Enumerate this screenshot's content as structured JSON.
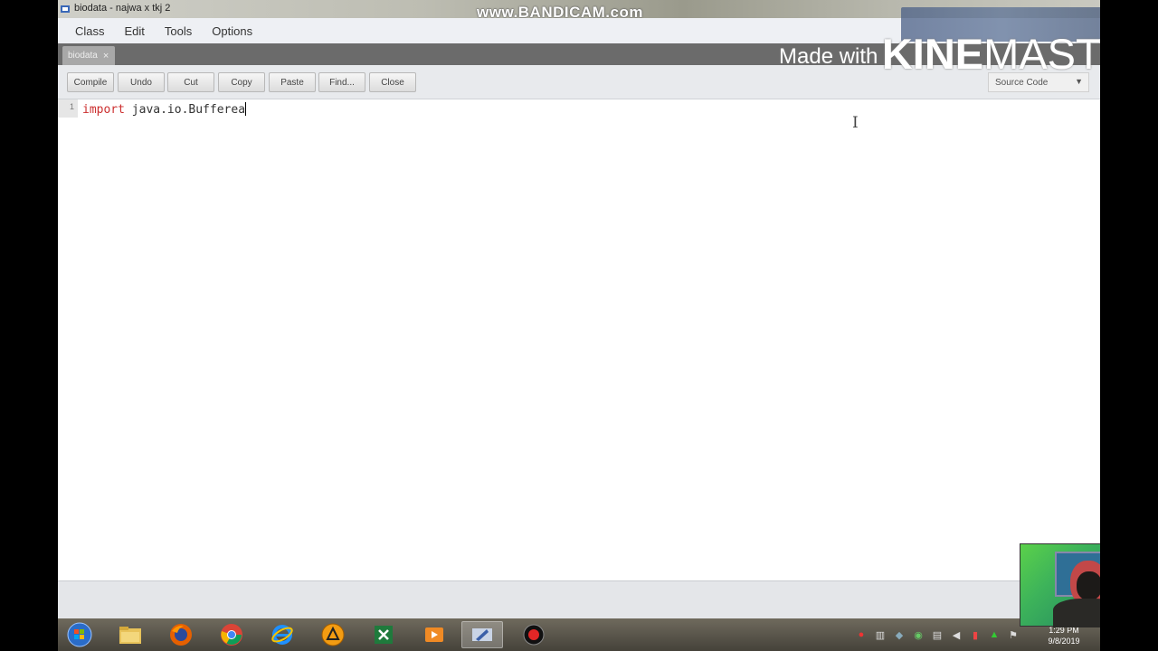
{
  "window": {
    "title": "biodata - najwa x tkj 2"
  },
  "watermarks": {
    "bandicam": "www.BANDICAM.com",
    "kinemaster_prefix": "Made with",
    "kinemaster_kine": "KINE",
    "kinemaster_master": "MASTER"
  },
  "menu": {
    "items": [
      "Class",
      "Edit",
      "Tools",
      "Options"
    ]
  },
  "tabs": [
    {
      "label": "biodata",
      "close": "×"
    }
  ],
  "toolbar": {
    "buttons": [
      "Compile",
      "Undo",
      "Cut",
      "Copy",
      "Paste",
      "Find...",
      "Close"
    ],
    "view_select": "Source Code"
  },
  "editor": {
    "line_number": "1",
    "keyword": "import",
    "code_rest": " java.io.Bufferea"
  },
  "clock": {
    "time": "1:29 PM",
    "date": "9/8/2019"
  },
  "icons": {
    "start": "windows-start-icon",
    "explorer": "folder-icon",
    "firefox": "firefox-icon",
    "chrome": "chrome-icon",
    "ie": "internet-explorer-icon",
    "app5": "warning-app-icon",
    "excel": "excel-icon",
    "media": "media-player-icon",
    "bluej": "bluej-icon",
    "record": "record-icon"
  }
}
